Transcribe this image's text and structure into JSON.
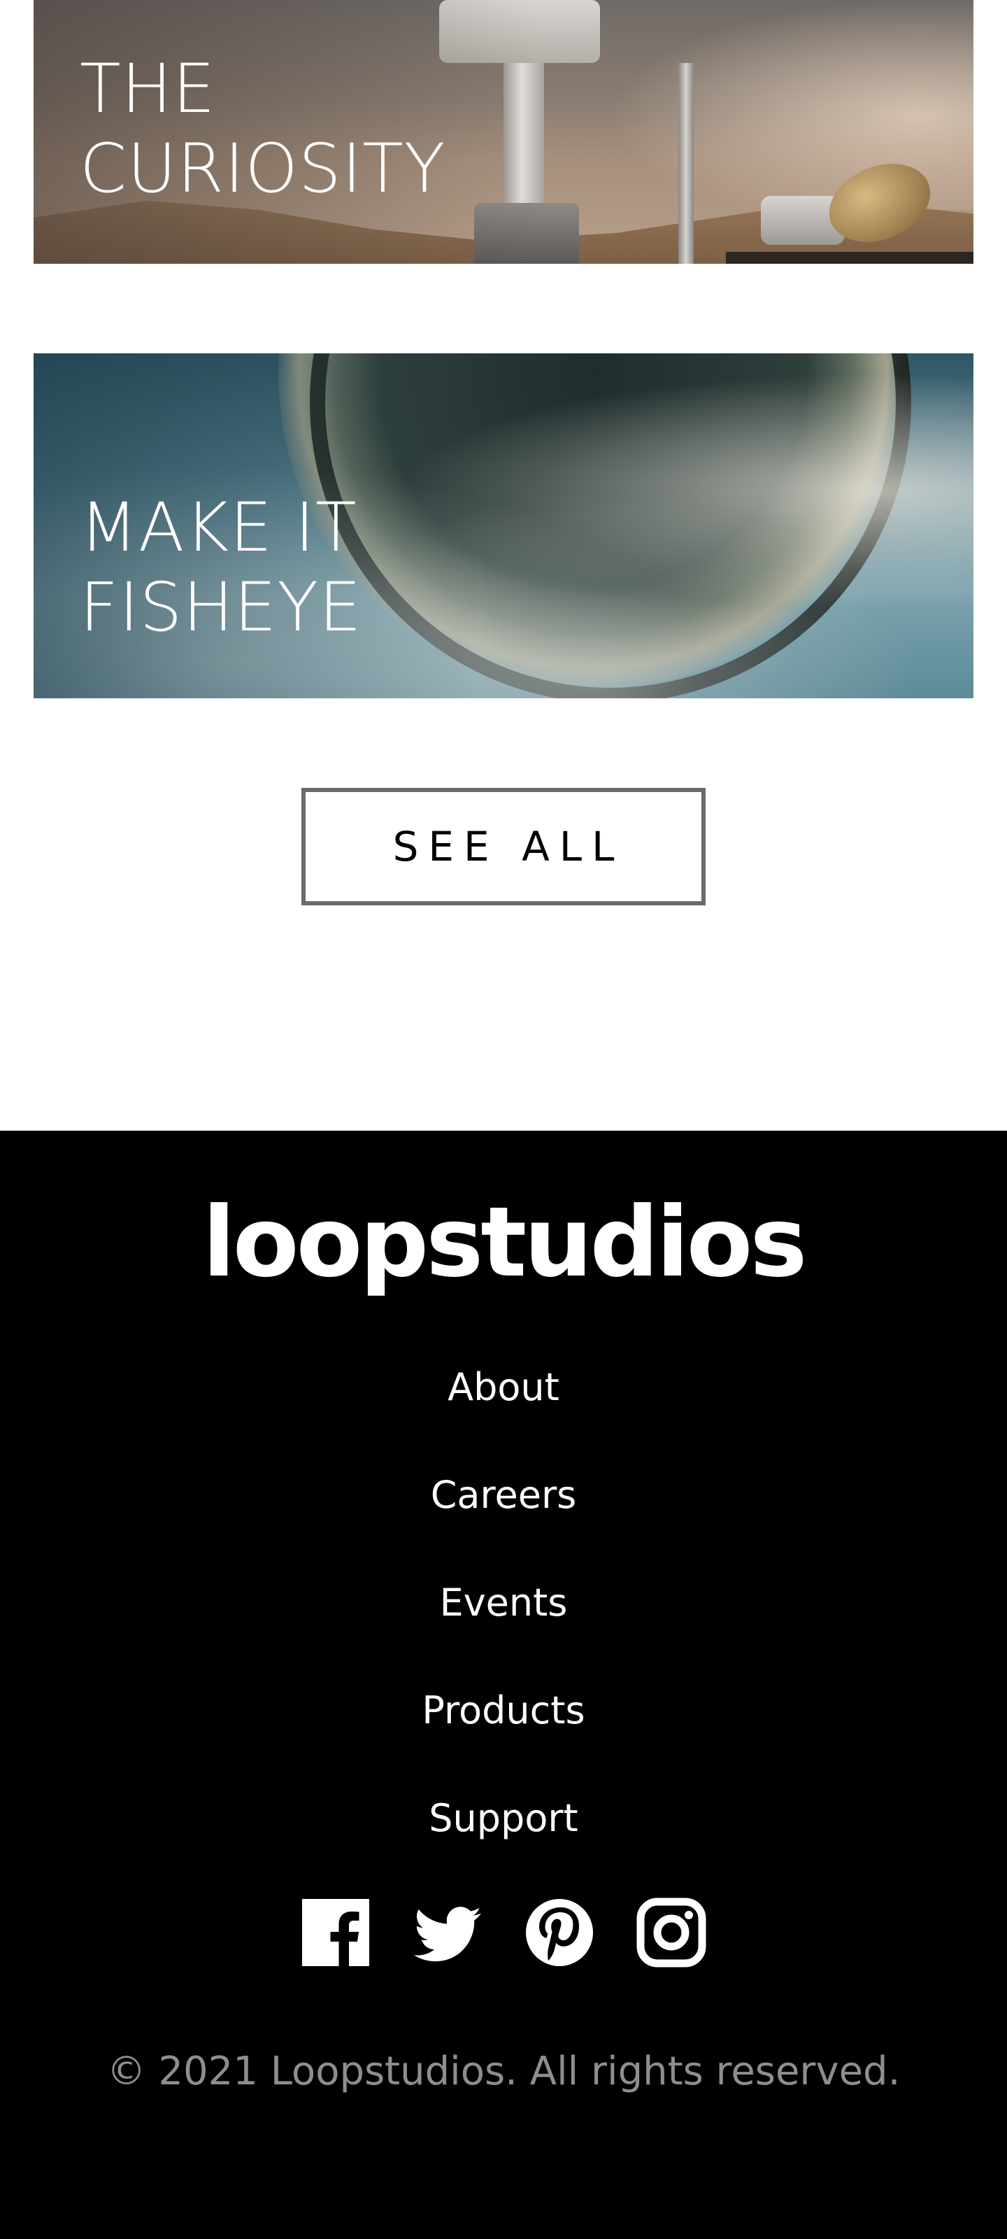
{
  "creations": {
    "cards": [
      {
        "line1": "THE",
        "line2": "CURIOSITY"
      },
      {
        "line1": "MAKE IT",
        "line2": "FISHEYE"
      }
    ],
    "see_all_label": "SEE ALL"
  },
  "footer": {
    "logo": "loopstudios",
    "links": [
      "About",
      "Careers",
      "Events",
      "Products",
      "Support"
    ],
    "social_icons": [
      "facebook-icon",
      "twitter-icon",
      "pinterest-icon",
      "instagram-icon"
    ],
    "copyright": "© 2021 Loopstudios. All rights reserved."
  },
  "colors": {
    "footer_background": "#000000",
    "footer_text": "#ffffff",
    "copyright_text": "#8e8e8e",
    "button_border": "#6b6b6b"
  }
}
